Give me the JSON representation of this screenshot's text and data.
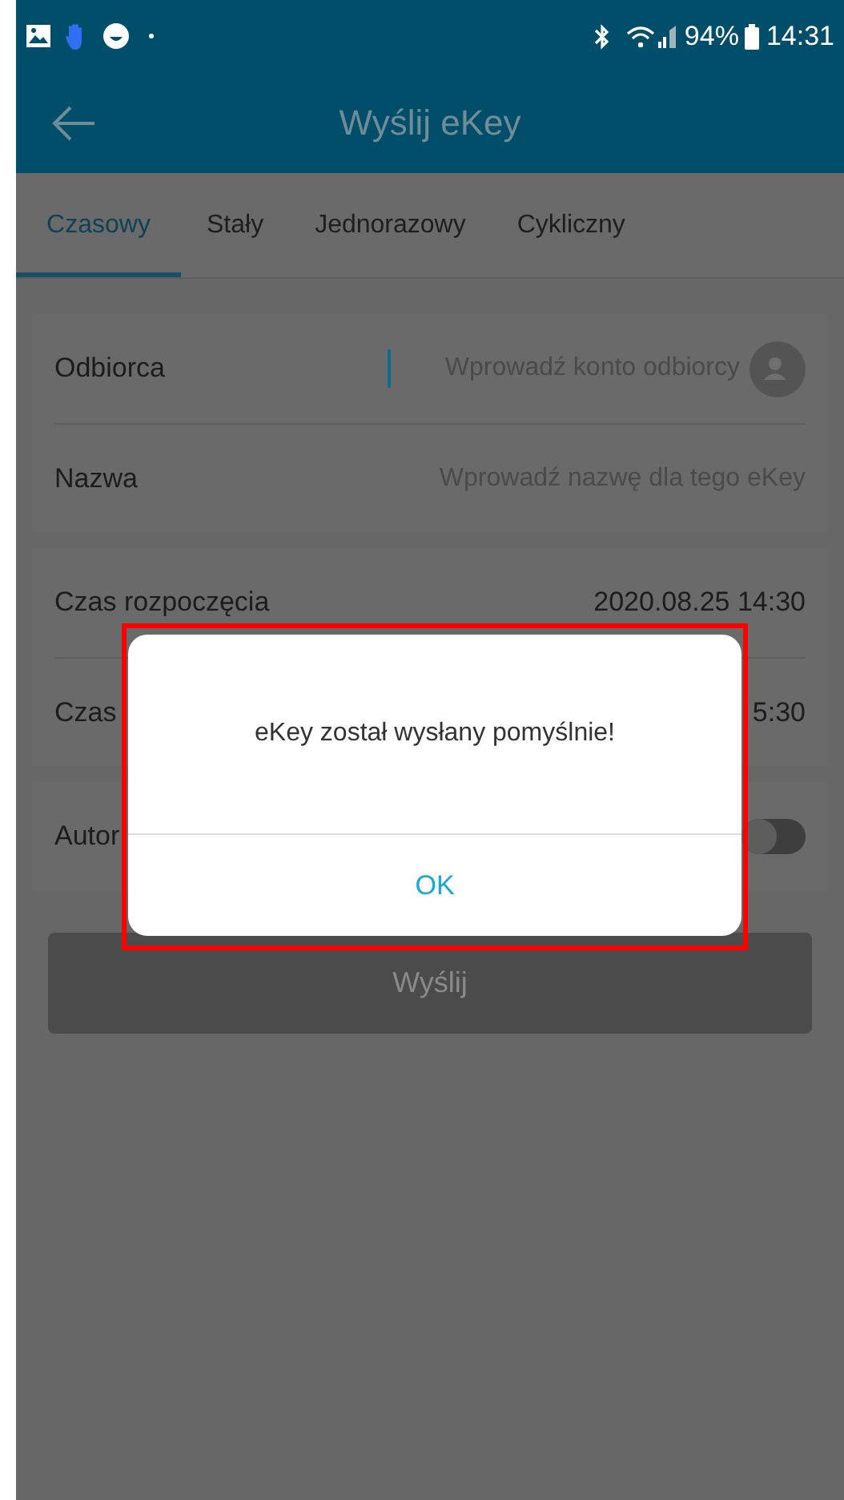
{
  "status_bar": {
    "battery": "94%",
    "time": "14:31"
  },
  "app_bar": {
    "title": "Wyślij eKey"
  },
  "tabs": [
    {
      "label": "Czasowy",
      "selected": true
    },
    {
      "label": "Stały",
      "selected": false
    },
    {
      "label": "Jednorazowy",
      "selected": false
    },
    {
      "label": "Cykliczny",
      "selected": false
    }
  ],
  "sections": [
    {
      "rows": [
        {
          "kind": "contact_input",
          "label": "Odbiorca",
          "placeholder": "Wprowadź konto odbiorcy",
          "focused": true
        },
        {
          "kind": "input",
          "label": "Nazwa",
          "placeholder": "Wprowadź nazwę dla tego eKey",
          "focused": false
        }
      ]
    },
    {
      "rows": [
        {
          "kind": "value",
          "label": "Czas rozpoczęcia",
          "value": "2020.08.25 14:30"
        },
        {
          "kind": "value",
          "label": "Czas",
          "value": "5:30"
        }
      ]
    },
    {
      "rows": [
        {
          "kind": "toggle",
          "label": "Autor",
          "on": false
        }
      ]
    }
  ],
  "send_button": "Wyślij",
  "dialog": {
    "message": "eKey został wysłany pomyślnie!",
    "button": "OK",
    "highlighted": true
  }
}
